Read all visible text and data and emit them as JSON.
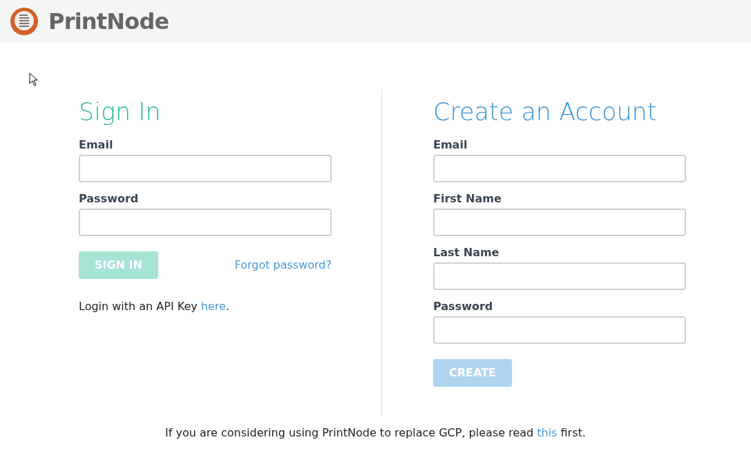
{
  "header": {
    "brand": "PrintNode"
  },
  "sign_in": {
    "title": "Sign In",
    "fields": [
      {
        "label": "Email"
      },
      {
        "label": "Password"
      }
    ],
    "button": {
      "label": "SIGN IN",
      "disabled": true
    },
    "forgot_link": "Forgot password?",
    "api_note": {
      "before": "Login with an API Key ",
      "link": "here",
      "after": "."
    }
  },
  "create_account": {
    "title": "Create an Account",
    "fields": [
      {
        "label": "Email"
      },
      {
        "label": "First Name"
      },
      {
        "label": "Last Name"
      },
      {
        "label": "Password"
      }
    ],
    "button": {
      "label": "CREATE",
      "disabled": true
    }
  },
  "footer_note": {
    "before": "If you are considering using PrintNode to replace GCP, please read ",
    "link": "this",
    "after": " first."
  }
}
